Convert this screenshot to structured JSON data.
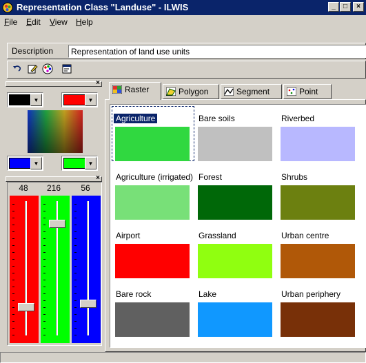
{
  "window": {
    "title": "Representation Class \"Landuse\" - ILWIS",
    "buttons": {
      "minimize": "_",
      "maximize": "□",
      "close": "×"
    }
  },
  "menu": [
    {
      "label": "File",
      "key": "F",
      "rest": "ile"
    },
    {
      "label": "Edit",
      "key": "E",
      "rest": "dit"
    },
    {
      "label": "View",
      "key": "V",
      "rest": "iew"
    },
    {
      "label": "Help",
      "key": "H",
      "rest": "elp"
    }
  ],
  "description": {
    "label": "Description",
    "value": "Representation of land use units"
  },
  "toolbar": [
    "undo-icon",
    "edit-icon",
    "palette-icon",
    "properties-icon"
  ],
  "color_panel": {
    "primary_color": "#000000",
    "secondary_color": "#ff0000",
    "lower_left_color": "#0000ff",
    "lower_right_color": "#00ff00",
    "sliders": [
      {
        "name": "red",
        "value": "48",
        "color": "#ff0000",
        "level": 0.19
      },
      {
        "name": "green",
        "value": "216",
        "color": "#00ff00",
        "level": 0.85
      },
      {
        "name": "blue",
        "value": "56",
        "color": "#0000ff",
        "level": 0.22
      }
    ]
  },
  "tabs": [
    {
      "label": "Raster",
      "active": true
    },
    {
      "label": "Polygon",
      "active": false
    },
    {
      "label": "Segment",
      "active": false
    },
    {
      "label": "Point",
      "active": false
    }
  ],
  "classes": [
    {
      "name": "Agriculture",
      "color": "#30d840",
      "selected": true
    },
    {
      "name": "Bare soils",
      "color": "#c0c0c0"
    },
    {
      "name": "Riverbed",
      "color": "#b8b8ff"
    },
    {
      "name": "Agriculture (irrigated)",
      "color": "#78e078"
    },
    {
      "name": "Forest",
      "color": "#006808"
    },
    {
      "name": "Shrubs",
      "color": "#6c8010"
    },
    {
      "name": "Airport",
      "color": "#ff0000"
    },
    {
      "name": "Grassland",
      "color": "#90ff10"
    },
    {
      "name": "Urban centre",
      "color": "#b05808"
    },
    {
      "name": "Bare rock",
      "color": "#606060"
    },
    {
      "name": "Lake",
      "color": "#1098ff"
    },
    {
      "name": "Urban periphery",
      "color": "#783008"
    }
  ]
}
